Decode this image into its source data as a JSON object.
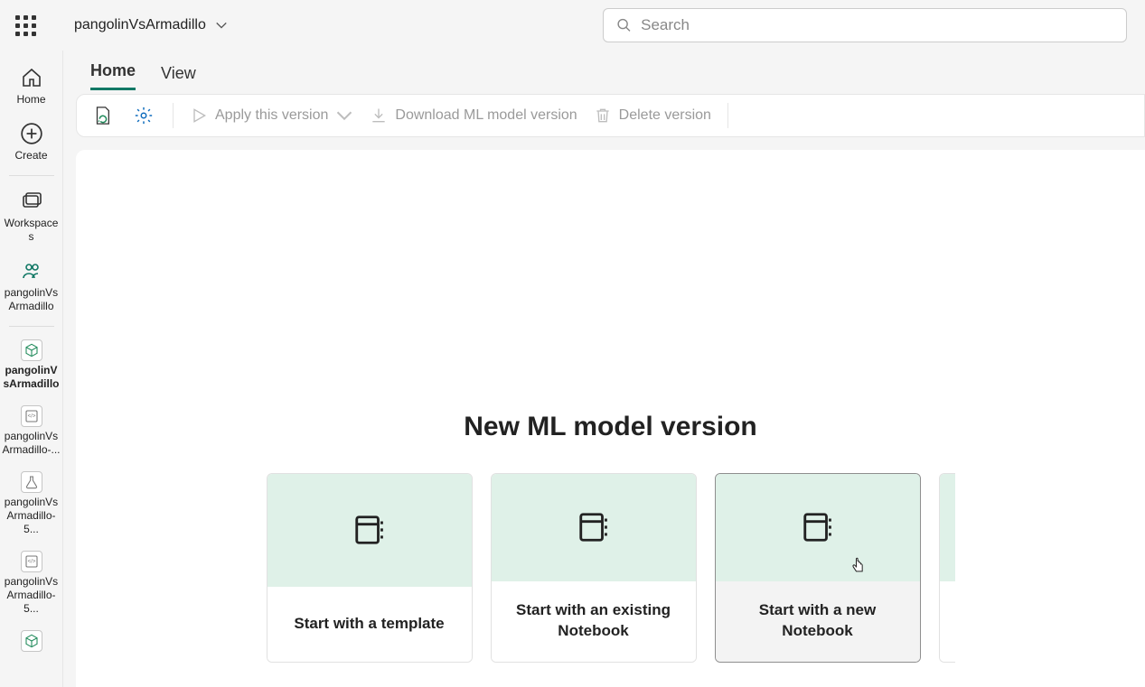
{
  "workspace": {
    "name": "pangolinVsArmadillo"
  },
  "search": {
    "placeholder": "Search"
  },
  "leftrail": {
    "home": "Home",
    "create": "Create",
    "workspaces": "Workspaces",
    "project": "pangolinVsArmadillo",
    "recent1": "pangolinVsArmadillo",
    "recent2": "pangolinVsArmadillo-...",
    "recent3": "pangolinVsArmadillo-5...",
    "recent4": "pangolinVsArmadillo-5..."
  },
  "tabs": {
    "home": "Home",
    "view": "View"
  },
  "toolbar": {
    "apply": "Apply this version",
    "download": "Download ML model version",
    "delete": "Delete version"
  },
  "main": {
    "title": "New ML model version",
    "card1": "Start with a template",
    "card2": "Start with an existing Notebook",
    "card3": "Start with a new Notebook"
  }
}
